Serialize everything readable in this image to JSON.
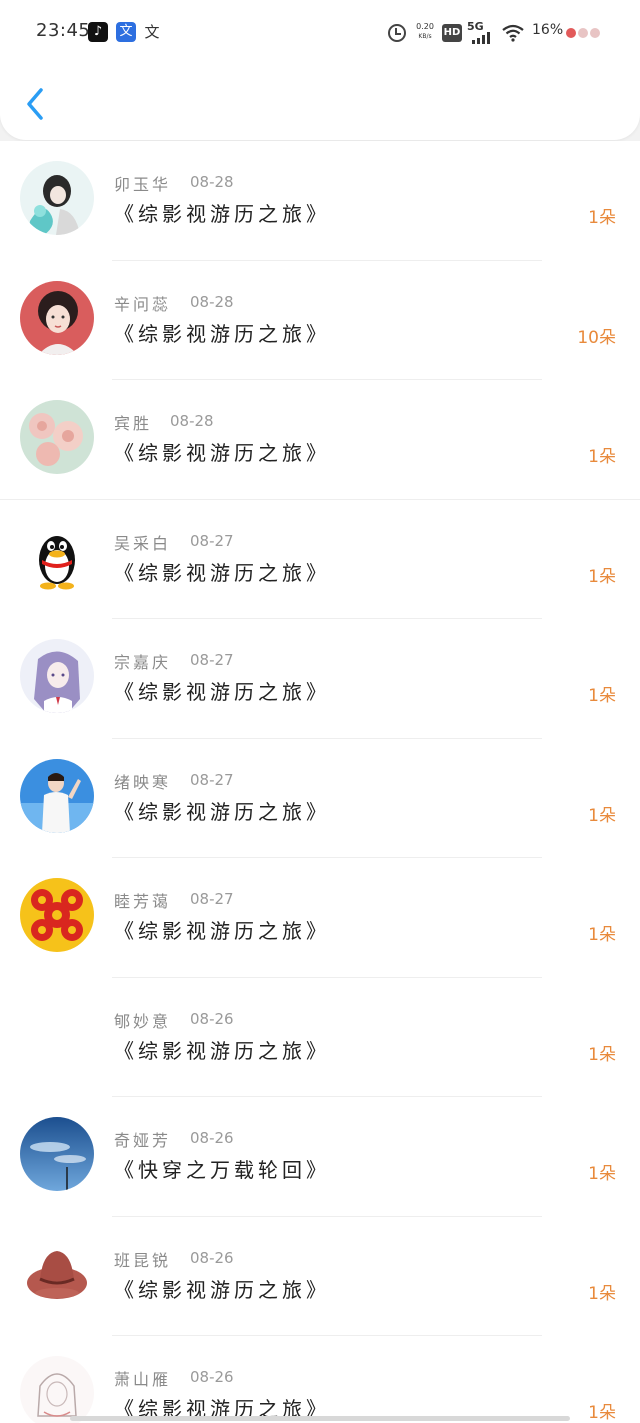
{
  "status_bar": {
    "time": "23:45",
    "app_icons": [
      "tiktok-icon",
      "wen-app-icon",
      "wen-text-icon"
    ],
    "net_speed_value": "0.20",
    "net_speed_unit": "KB/s",
    "hd_label": "HD",
    "signal_label": "5G",
    "battery": "16%"
  },
  "header": {
    "back_icon": "chevron-left-icon",
    "accent_color": "#2a9df4"
  },
  "rows": [
    {
      "name": "卯玉华",
      "date": "08-28",
      "book": "《综影视游历之旅》",
      "count": "1朵"
    },
    {
      "name": "辛问蕊",
      "date": "08-28",
      "book": "《综影视游历之旅》",
      "count": "10朵"
    },
    {
      "name": "宾胜",
      "date": "08-28",
      "book": "《综影视游历之旅》",
      "count": "1朵"
    },
    {
      "name": "吴采白",
      "date": "08-27",
      "book": "《综影视游历之旅》",
      "count": "1朵"
    },
    {
      "name": "宗嘉庆",
      "date": "08-27",
      "book": "《综影视游历之旅》",
      "count": "1朵"
    },
    {
      "name": "绪映寒",
      "date": "08-27",
      "book": "《综影视游历之旅》",
      "count": "1朵"
    },
    {
      "name": "睦芳蔼",
      "date": "08-27",
      "book": "《综影视游历之旅》",
      "count": "1朵"
    },
    {
      "name": "郇妙意",
      "date": "08-26",
      "book": "《综影视游历之旅》",
      "count": "1朵"
    },
    {
      "name": "奇娅芳",
      "date": "08-26",
      "book": "《快穿之万载轮回》",
      "count": "1朵"
    },
    {
      "name": "班昆锐",
      "date": "08-26",
      "book": "《综影视游历之旅》",
      "count": "1朵"
    },
    {
      "name": "萧山雁",
      "date": "08-26",
      "book": "《综影视游历之旅》",
      "count": "1朵"
    }
  ],
  "colors": {
    "count": "#e88a3c",
    "name": "#8a8a8a",
    "book": "#222222"
  }
}
